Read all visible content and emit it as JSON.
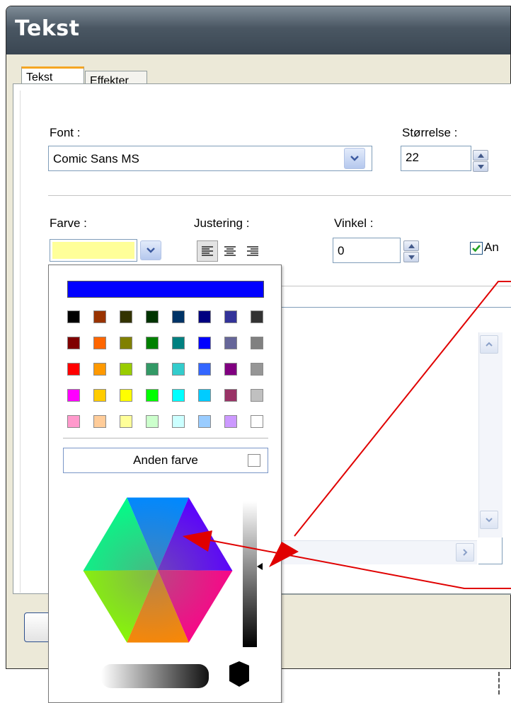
{
  "window": {
    "title": "Tekst"
  },
  "tabs": [
    {
      "label": "Tekst",
      "active": true
    },
    {
      "label": "Effekter",
      "active": false
    }
  ],
  "font": {
    "label": "Font :",
    "value": "Comic Sans MS"
  },
  "size": {
    "label": "Størrelse :",
    "value": "22"
  },
  "color": {
    "label": "Farve :",
    "selected": "#ffff99"
  },
  "alignment": {
    "label": "Justering :",
    "options": [
      "left",
      "center",
      "right"
    ],
    "selected": "left"
  },
  "angle": {
    "label": "Vinkel :",
    "value": "0"
  },
  "checkbox": {
    "label": "An",
    "checked": true
  },
  "color_popup": {
    "automatic_color": "#0000ff",
    "palette": [
      [
        "#000000",
        "#993300",
        "#333300",
        "#003300",
        "#003366",
        "#000080",
        "#333399",
        "#333333"
      ],
      [
        "#800000",
        "#ff6600",
        "#808000",
        "#008000",
        "#008080",
        "#0000ff",
        "#666699",
        "#808080"
      ],
      [
        "#ff0000",
        "#ff9900",
        "#99cc00",
        "#339966",
        "#33cccc",
        "#3366ff",
        "#800080",
        "#969696"
      ],
      [
        "#ff00ff",
        "#ffcc00",
        "#ffff00",
        "#00ff00",
        "#00ffff",
        "#00ccff",
        "#993366",
        "#c0c0c0"
      ],
      [
        "#ff99cc",
        "#ffcc99",
        "#ffff99",
        "#ccffcc",
        "#ccffff",
        "#99ccff",
        "#cc99ff",
        "#ffffff"
      ]
    ],
    "other_color_label": "Anden farve"
  },
  "annotations": {
    "arrow_color": "#e00000"
  }
}
